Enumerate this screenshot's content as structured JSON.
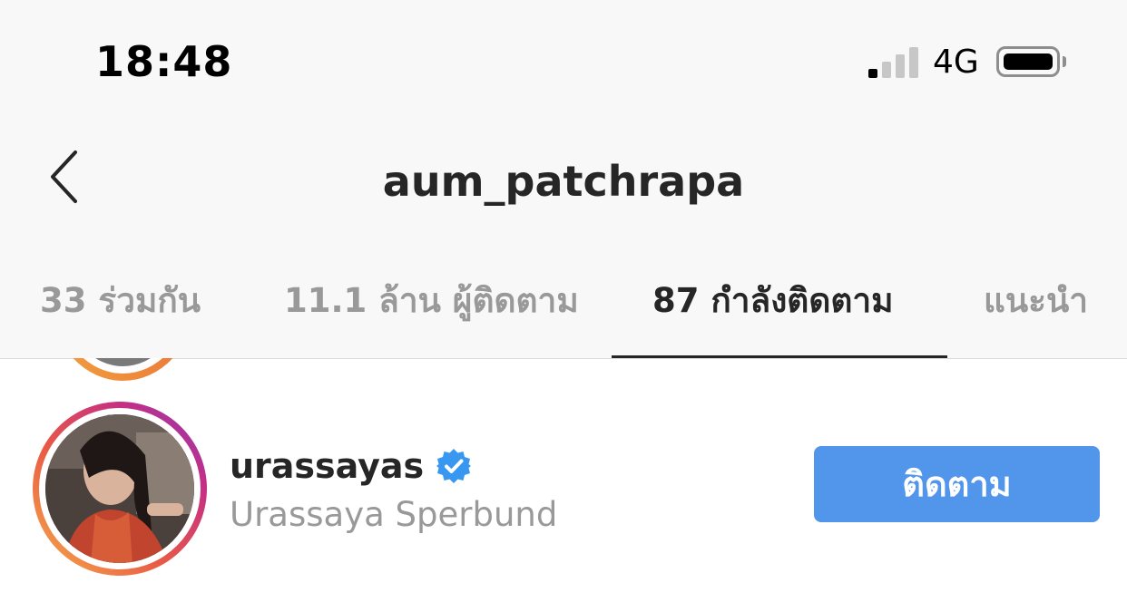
{
  "status_bar": {
    "time": "18:48",
    "network": "4G"
  },
  "header": {
    "title": "aum_patchrapa"
  },
  "tabs": [
    {
      "label": "33 ร่วมกัน",
      "active": false
    },
    {
      "label": "11.1 ล้าน ผู้ติดตาม",
      "active": false
    },
    {
      "label": "87 กำลังติดตาม",
      "active": true
    },
    {
      "label": "แนะนำ",
      "active": false
    }
  ],
  "list": {
    "rows": [
      {
        "username": "urassayas",
        "full_name": "Urassaya Sperbund",
        "verified": true,
        "button_label": "ติดตาม"
      }
    ]
  },
  "colors": {
    "accent": "#5196ea",
    "verified": "#3897f0",
    "text_primary": "#262626",
    "text_secondary": "#999999",
    "header_bg": "#f8f8f8"
  },
  "icons": {
    "back": "chevron-left-icon",
    "verified": "verified-badge-icon",
    "signal": "signal-strength-icon",
    "battery": "battery-icon"
  }
}
